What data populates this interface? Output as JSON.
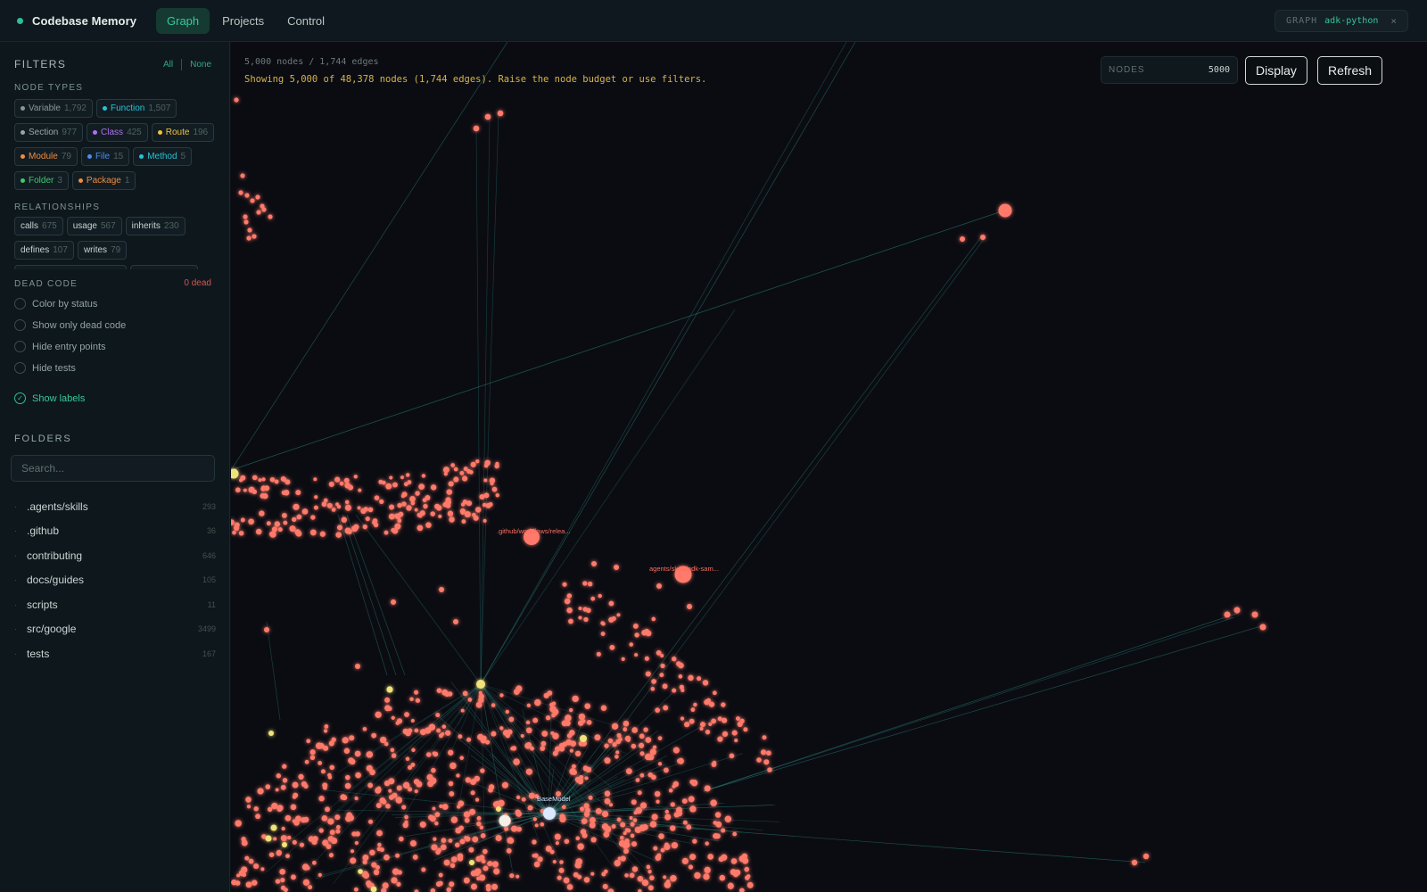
{
  "app": {
    "title": "Codebase Memory"
  },
  "nav": {
    "tabs": [
      {
        "label": "Graph"
      },
      {
        "label": "Projects"
      },
      {
        "label": "Control"
      }
    ]
  },
  "graph_chip": {
    "label": "GRAPH",
    "value": "adk-python",
    "close_glyph": "×"
  },
  "sidebar": {
    "filters_title": "FILTERS",
    "all_label": "All",
    "none_label": "None",
    "node_types_title": "NODE TYPES",
    "node_types": [
      {
        "label": "Variable",
        "count": "1,792",
        "color": "#8a9694"
      },
      {
        "label": "Function",
        "count": "1,507",
        "color": "#27c2d6"
      },
      {
        "label": "Section",
        "count": "977",
        "color": "#9aa6a4"
      },
      {
        "label": "Class",
        "count": "425",
        "color": "#b36ef0"
      },
      {
        "label": "Route",
        "count": "196",
        "color": "#f0c33c"
      },
      {
        "label": "Module",
        "count": "79",
        "color": "#f28b3c"
      },
      {
        "label": "File",
        "count": "15",
        "color": "#4b8ef0"
      },
      {
        "label": "Method",
        "count": "5",
        "color": "#27c2d6"
      },
      {
        "label": "Folder",
        "count": "3",
        "color": "#3fc96b"
      },
      {
        "label": "Package",
        "count": "1",
        "color": "#f28b3c"
      }
    ],
    "relationships_title": "RELATIONSHIPS",
    "relationships": [
      {
        "label": "calls",
        "count": "675"
      },
      {
        "label": "usage",
        "count": "567"
      },
      {
        "label": "inherits",
        "count": "230"
      },
      {
        "label": "defines",
        "count": "107"
      },
      {
        "label": "writes",
        "count": "79"
      },
      {
        "label": "",
        "count": ""
      },
      {
        "label": "",
        "count": ""
      }
    ],
    "dead_code_title": "DEAD CODE",
    "dead_code_count": "0 dead",
    "options": [
      {
        "label": "Color by status",
        "checked": false
      },
      {
        "label": "Show only dead code",
        "checked": false
      },
      {
        "label": "Hide entry points",
        "checked": false
      },
      {
        "label": "Hide tests",
        "checked": false
      }
    ],
    "show_labels": {
      "label": "Show labels",
      "checked": true
    },
    "folders_title": "FOLDERS",
    "search_placeholder": "Search...",
    "folders": [
      {
        "name": ".agents/skills",
        "count": "293"
      },
      {
        "name": ".github",
        "count": "36"
      },
      {
        "name": "contributing",
        "count": "646"
      },
      {
        "name": "docs/guides",
        "count": "105"
      },
      {
        "name": "scripts",
        "count": "11"
      },
      {
        "name": "src/google",
        "count": "3499"
      },
      {
        "name": "tests",
        "count": "167"
      }
    ]
  },
  "canvas": {
    "stats": "5,000 nodes / 1,744 edges",
    "warning": "Showing 5,000 of 48,378 nodes (1,744 edges). Raise the node budget or use filters.",
    "nodes_label": "NODES",
    "nodes_value": "5000",
    "display_label": "Display",
    "refresh_label": "Refresh",
    "node_labels": [
      {
        "text": ".github/workflows/relea..."
      },
      {
        "text": "agents/skills/adk-sam..."
      },
      {
        "text": "BaseModel"
      }
    ],
    "colors": {
      "node": "#ff7a6b",
      "edge": "#2b8f86",
      "highlight": "#f2e27a",
      "focus": "#ffffff"
    }
  }
}
